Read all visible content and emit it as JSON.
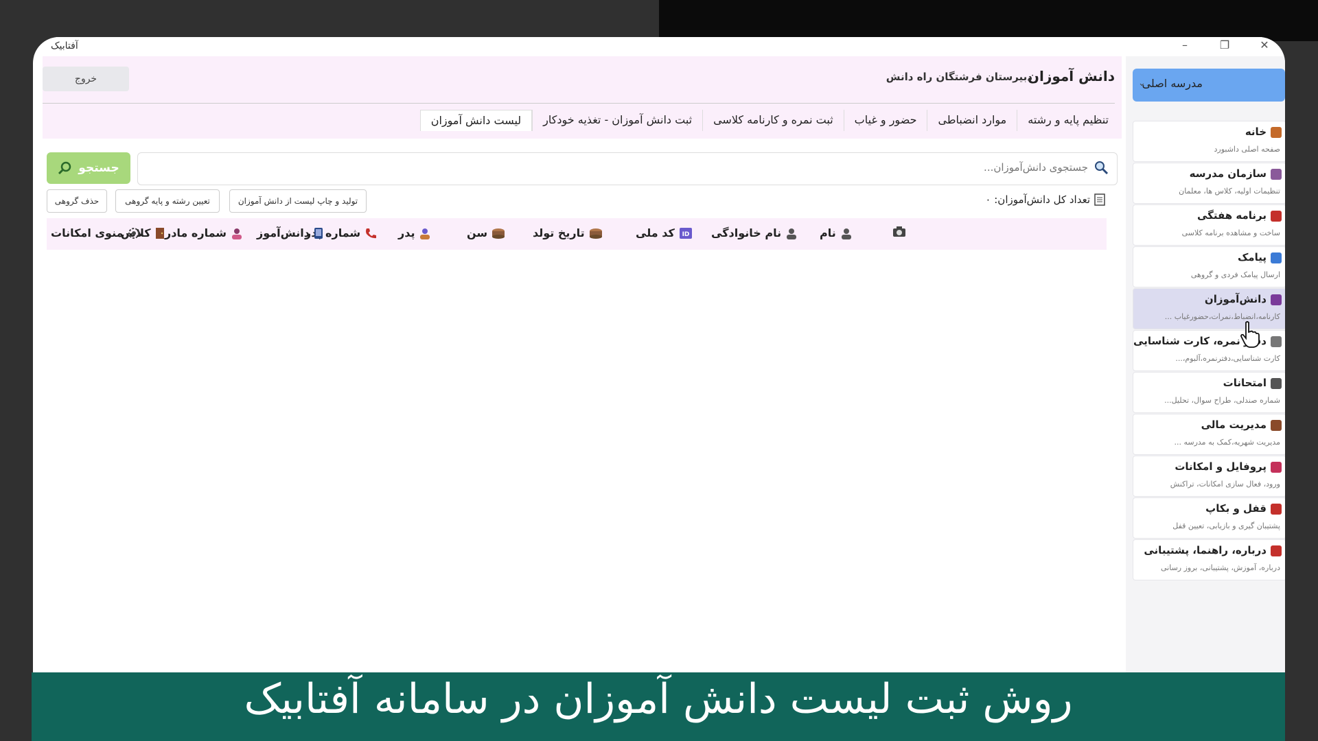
{
  "window": {
    "app_title": "آفتابیک"
  },
  "header": {
    "page_title": "دانش آموزان",
    "school_name": "دبیرستان فرشتگان راه دانش",
    "exit_label": "خروج"
  },
  "tabs": [
    "لیست دانش آموزان",
    "ثبت دانش آموزان - تغذیه خودکار",
    "ثبت نمره و کارنامه کلاسی",
    "حضور و غیاب",
    "موارد انضباطی",
    "تنظیم پایه و رشته"
  ],
  "search": {
    "placeholder": "جستجوی دانش‌آموزان...",
    "button_label": "جستجو"
  },
  "students": {
    "total_label": "تعداد کل دانش‌آموزان: ۰",
    "actions": [
      "تولید و چاپ لیست از دانش آموزان",
      "تعیین رشته و پایه گروهی",
      "حذف گروهی"
    ]
  },
  "table": {
    "columns": [
      "نام",
      "نام خانوادگی",
      "کد ملی",
      "تاریخ تولد",
      "سن",
      "پدر",
      "شماره پدر",
      "دانش‌آموز",
      "شماره مادر",
      "کلاس",
      "منوی امکانات"
    ]
  },
  "sidebar": {
    "school_select": "مدرسه اصلی",
    "items": [
      {
        "title": "خانه",
        "desc": "صفحه اصلی داشبورد",
        "icon": "clock-icon",
        "color": "#c46a2a"
      },
      {
        "title": "سازمان مدرسه",
        "desc": "تنظیمات اولیه، کلاس ها، معلمان",
        "icon": "school-icon",
        "color": "#8a5a9a"
      },
      {
        "title": "برنامه هفتگی",
        "desc": "ساخت و مشاهده برنامه کلاسی",
        "icon": "calendar-icon",
        "color": "#c4302b"
      },
      {
        "title": "پیامک",
        "desc": "ارسال پیامک فردی و گروهی",
        "icon": "message-icon",
        "color": "#3b7bd6"
      },
      {
        "title": "دانش‌آموزان",
        "desc": "کارنامه،انضباط،نمرات،حضورغیاب ...",
        "icon": "student-icon",
        "color": "#7a3a9a"
      },
      {
        "title": "دفتر نمره، کارت شناسایی",
        "desc": "کارت شناسایی،دفترنمره،آلبوم،...",
        "icon": "notebook-icon",
        "color": "#777777"
      },
      {
        "title": "امتحانات",
        "desc": "شماره صندلی، طراح سوال، تحلیل...",
        "icon": "exam-icon",
        "color": "#555555"
      },
      {
        "title": "مدیریت مالی",
        "desc": "مدیریت شهریه،کمک به مدرسه ...",
        "icon": "briefcase-icon",
        "color": "#8a4a2a"
      },
      {
        "title": "پروفایل و امکانات",
        "desc": "ورود، فعال سازی امکانات، تراکنش",
        "icon": "toolbox-icon",
        "color": "#c4305a"
      },
      {
        "title": "قفل و بکاپ",
        "desc": "پشتیبان گیری و بازیابی، تعیین قفل",
        "icon": "shield-icon",
        "color": "#c4302b"
      },
      {
        "title": "درباره، راهنما، پشتیبانی",
        "desc": "درباره، آموزش، پشتیبانی، بروز رسانی",
        "icon": "phone-icon",
        "color": "#c4302b"
      }
    ]
  },
  "banner": {
    "text": "روش ثبت لیست دانش آموزان در سامانه آفتابیک"
  }
}
